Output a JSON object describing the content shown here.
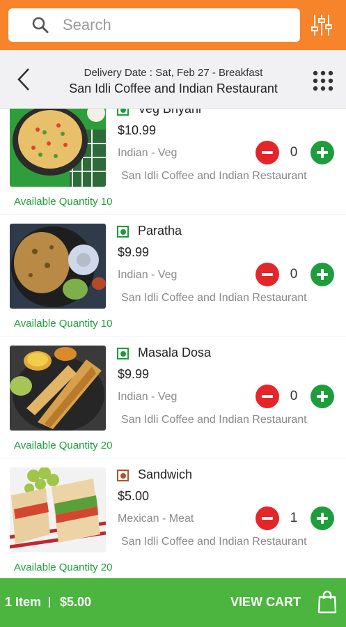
{
  "search": {
    "placeholder": "Search"
  },
  "header": {
    "delivery": "Delivery Date : Sat, Feb 27 - Breakfast",
    "restaurant": "San Idli Coffee and Indian Restaurant"
  },
  "items": [
    {
      "name": "Veg Briyani",
      "price": "$10.99",
      "cuisine": "Indian - Veg",
      "restaurant": "San Idli Coffee and Indian Restaurant",
      "qty_label": "Available Quantity 10",
      "count": "0",
      "type": "veg"
    },
    {
      "name": "Paratha",
      "price": "$9.99",
      "cuisine": "Indian - Veg",
      "restaurant": "San Idli Coffee and Indian Restaurant",
      "qty_label": "Available Quantity 10",
      "count": "0",
      "type": "veg"
    },
    {
      "name": "Masala Dosa",
      "price": "$9.99",
      "cuisine": "Indian - Veg",
      "restaurant": "San Idli Coffee and Indian Restaurant",
      "qty_label": "Available Quantity 20",
      "count": "0",
      "type": "veg"
    },
    {
      "name": "Sandwich",
      "price": "$5.00",
      "cuisine": "Mexican - Meat",
      "restaurant": "San Idli Coffee and Indian Restaurant",
      "qty_label": "Available Quantity 20",
      "count": "1",
      "type": "meat"
    }
  ],
  "cart": {
    "items": "1 Item",
    "total": "$5.00",
    "view": "VIEW CART"
  },
  "icons": {
    "search": "search-icon",
    "filter": "sliders-icon",
    "back": "chevron-left-icon",
    "menu": "grid-icon",
    "minus": "minus-icon",
    "plus": "plus-icon",
    "bag": "shopping-bag-icon"
  },
  "colors": {
    "header": "#f7832b",
    "cart": "#4bb53f",
    "minus": "#e5252a",
    "plus": "#1f9d3d",
    "veg": "#1c9a3a",
    "meat": "#b5502a"
  }
}
